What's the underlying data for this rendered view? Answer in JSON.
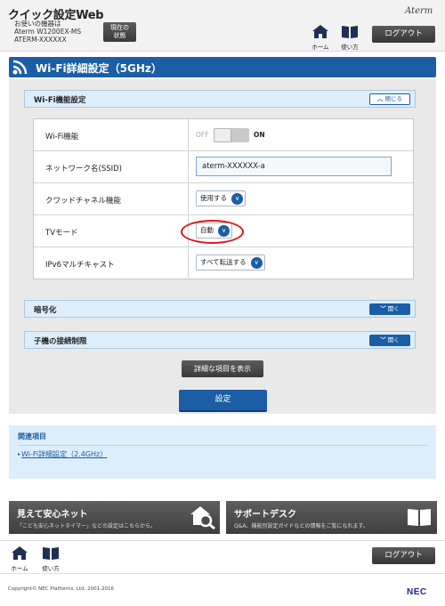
{
  "header": {
    "app_title": "クイック設定Web",
    "device_line1": "お使いの機器は",
    "device_line2": "Aterm W1200EX-MS",
    "device_line3": "ATERM-XXXXXX",
    "status_btn_line1": "現在の",
    "status_btn_line2": "状態",
    "brand_logo": "Aterm",
    "home_label": "ホーム",
    "help_label": "使い方",
    "logout_label": "ログアウト"
  },
  "page_title": "Wi-Fi詳細設定（5GHz）",
  "sections": {
    "wifi_function": {
      "title": "Wi-Fi機能設定",
      "toggle_label": "閉じる",
      "state": "expanded"
    },
    "encryption": {
      "title": "暗号化",
      "toggle_label": "開く",
      "state": "collapsed"
    },
    "client_restriction": {
      "title": "子機の接続制限",
      "toggle_label": "開く",
      "state": "collapsed"
    }
  },
  "settings": {
    "wifi": {
      "label": "Wi-Fi機能",
      "off_label": "OFF",
      "on_label": "ON",
      "value": "ON"
    },
    "ssid": {
      "label": "ネットワーク名(SSID)",
      "value": "aterm-XXXXXX-a"
    },
    "quad_channel": {
      "label": "クワッドチャネル機能",
      "value": "使用する"
    },
    "tv_mode": {
      "label": "TVモード",
      "value": "自動"
    },
    "ipv6_multicast": {
      "label": "IPv6マルチキャスト",
      "value": "すべて転送する"
    }
  },
  "buttons": {
    "show_details": "詳細な項目を表示",
    "apply": "設定"
  },
  "related": {
    "header": "関連項目",
    "link_24ghz": "Wi-Fi詳細設定（2.4GHz）"
  },
  "promos": {
    "anshin": {
      "title": "見えて安心ネット",
      "desc": "「こども安心ネットタイマー」などの設定はこちらから。"
    },
    "support": {
      "title": "サポートデスク",
      "desc": "Q&A、機能別設定ガイドなどの情報をご覧になれます。"
    }
  },
  "footer": {
    "home_label": "ホーム",
    "help_label": "使い方",
    "logout_label": "ログアウト",
    "copyright": "Copyright© NEC Platforms, Ltd. 2001-2016",
    "company_logo": "NEC"
  },
  "colors": {
    "brand_blue": "#1b5ea6",
    "section_bg": "#ddeefa",
    "highlight_ring": "#e0161d"
  },
  "icons": {
    "title": "wifi-icon",
    "home": "home-icon",
    "help": "book-icon",
    "anshin": "house-search-icon",
    "support": "book-icon"
  }
}
